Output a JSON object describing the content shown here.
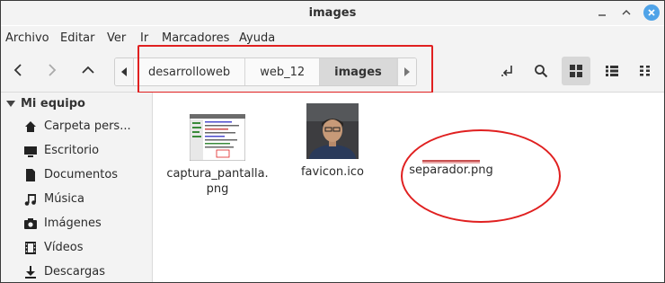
{
  "window": {
    "title": "images"
  },
  "menu": [
    "Archivo",
    "Editar",
    "Ver",
    "Ir",
    "Marcadores",
    "Ayuda"
  ],
  "pathbar": {
    "crumbs": [
      "desarrolloweb",
      "web_12",
      "images"
    ],
    "active": "images"
  },
  "sidebar": {
    "header": "Mi equipo",
    "items": [
      {
        "label": "Carpeta pers...",
        "icon": "home-icon"
      },
      {
        "label": "Escritorio",
        "icon": "desktop-icon"
      },
      {
        "label": "Documentos",
        "icon": "document-icon"
      },
      {
        "label": "Música",
        "icon": "music-icon"
      },
      {
        "label": "Imágenes",
        "icon": "camera-icon"
      },
      {
        "label": "Vídeos",
        "icon": "film-icon"
      },
      {
        "label": "Descargas",
        "icon": "download-icon"
      }
    ]
  },
  "files": [
    {
      "name_line1": "captura_pantalla.",
      "name_line2": "png",
      "icon": "screenshot-thumbnail"
    },
    {
      "name_line1": "favicon.ico",
      "icon": "photo-thumbnail"
    },
    {
      "name_line1": "separador.png",
      "icon": "separator-thumbnail"
    }
  ],
  "colors": {
    "annotation": "#e02020",
    "close_button": "#4fa3e8",
    "selected_view": "#d7d7d7"
  }
}
